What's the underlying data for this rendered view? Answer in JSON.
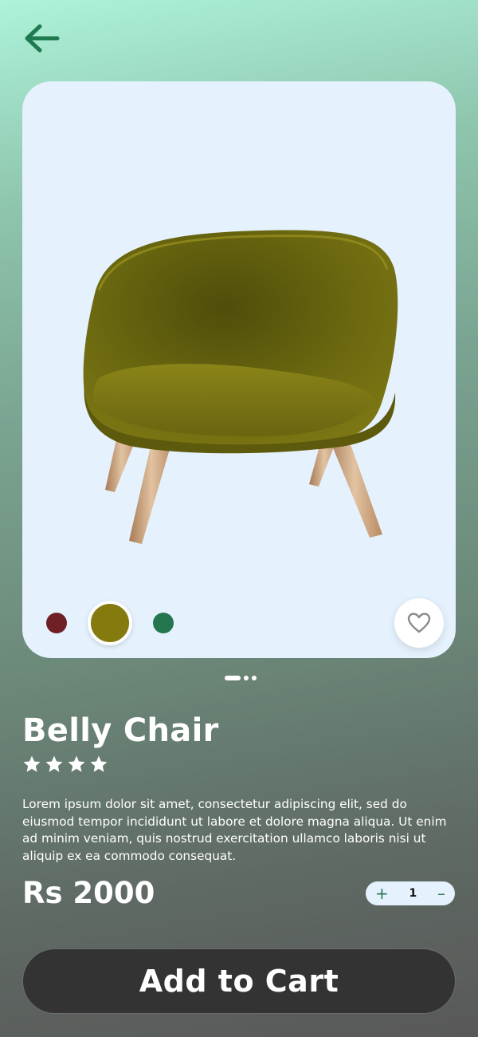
{
  "header": {
    "back_icon": "arrow-left-icon",
    "accent_color": "#1f7a4f"
  },
  "product": {
    "title": "Belly Chair",
    "rating": 4,
    "description": "Lorem ipsum dolor sit amet, consectetur adipiscing elit, sed do eiusmod tempor incididunt ut labore et dolore magna aliqua. Ut enim ad minim veniam, quis nostrud exercitation ullamco laboris nisi ut aliquip ex ea commodo consequat.",
    "price": "Rs 2000",
    "colors": [
      "#6f2027",
      "#857a0e",
      "#23764e"
    ],
    "selected_color": "#857a0e",
    "carousel": {
      "total": 3,
      "active": 1
    }
  },
  "quantity": {
    "plus": "+",
    "value": "1",
    "minus": "–"
  },
  "cart": {
    "label": "Add to Cart"
  }
}
